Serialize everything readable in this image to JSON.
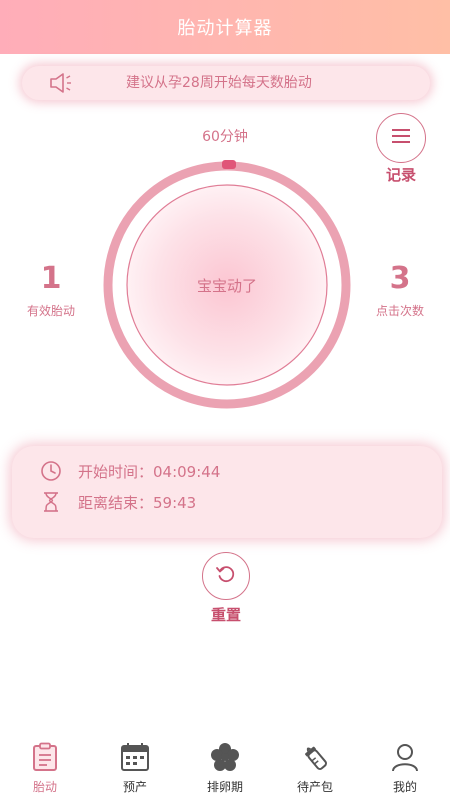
{
  "header": {
    "title": "胎动计算器"
  },
  "tip": {
    "text": "建议从孕28周开始每天数胎动"
  },
  "timer": {
    "duration_label": "60分钟",
    "progress": 0.0
  },
  "record": {
    "label": "记录"
  },
  "dial": {
    "center_label": "宝宝动了"
  },
  "stats": {
    "effective": {
      "value": "1",
      "label": "有效胎动"
    },
    "clicks": {
      "value": "3",
      "label": "点击次数"
    }
  },
  "times": {
    "start": "开始时间：04:09:44",
    "remaining": "距离结束：59:43"
  },
  "reset": {
    "label": "重置"
  },
  "tabs": [
    {
      "label": "胎动",
      "icon": "clipboard-icon",
      "active": true
    },
    {
      "label": "预产",
      "icon": "calendar-icon",
      "active": false
    },
    {
      "label": "排卵期",
      "icon": "flower-icon",
      "active": false
    },
    {
      "label": "待产包",
      "icon": "baby-bottle-icon",
      "active": false
    },
    {
      "label": "我的",
      "icon": "user-icon",
      "active": false
    }
  ],
  "colors": {
    "accent": "#d4738a",
    "header_start": "#ffadb9",
    "header_end": "#ffbfa6",
    "card_bg": "#fde6ea"
  }
}
